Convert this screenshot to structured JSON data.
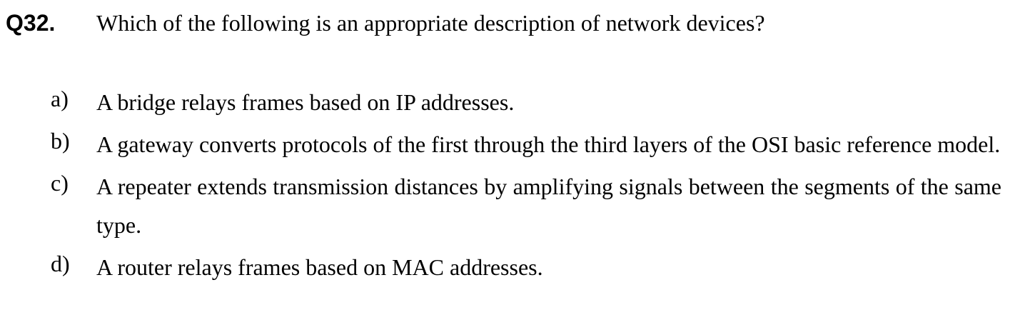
{
  "question": {
    "number": "Q32.",
    "text": "Which of the following is an appropriate description of network devices?"
  },
  "options": [
    {
      "label": "a)",
      "text": "A bridge relays frames based on IP addresses."
    },
    {
      "label": "b)",
      "text": "A gateway converts protocols of the first through the third layers of the OSI basic reference model."
    },
    {
      "label": "c)",
      "text": "A repeater extends transmission distances by amplifying signals between the segments of the same type."
    },
    {
      "label": "d)",
      "text": "A router relays frames based on MAC addresses."
    }
  ]
}
